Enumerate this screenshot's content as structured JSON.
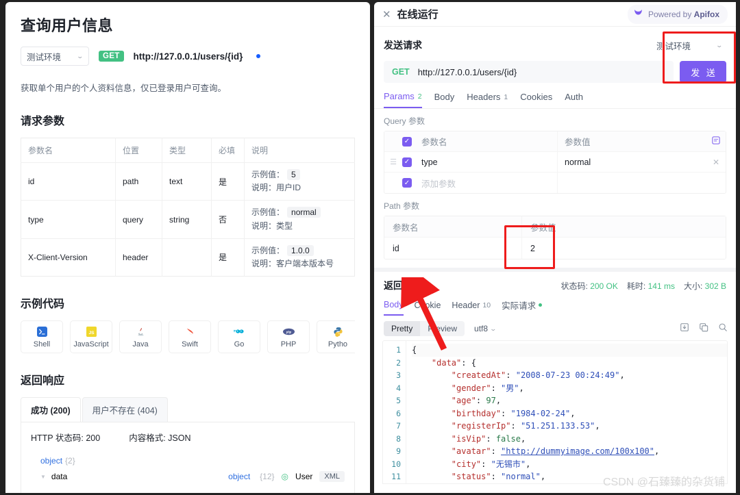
{
  "doc": {
    "title": "查询用户信息",
    "env_label": "测试环境",
    "method": "GET",
    "url": "http://127.0.0.1/users/{id}",
    "description": "获取单个用户的个人资料信息，仅已登录用户可查询。",
    "params_section_title": "请求参数",
    "params_headers": [
      "参数名",
      "位置",
      "类型",
      "必填",
      "说明"
    ],
    "params_rows": [
      {
        "name": "id",
        "position": "path",
        "type": "text",
        "required": "是",
        "example_label": "示例值：",
        "example_value": "5",
        "desc_label": "说明：",
        "desc_value": "用户ID"
      },
      {
        "name": "type",
        "position": "query",
        "type": "string",
        "required": "否",
        "example_label": "示例值：",
        "example_value": "normal",
        "desc_label": "说明：",
        "desc_value": "类型"
      },
      {
        "name": "X-Client-Version",
        "position": "header",
        "type": "",
        "required": "是",
        "example_label": "示例值：",
        "example_value": "1.0.0",
        "desc_label": "说明：",
        "desc_value": "客户端本版本号"
      }
    ],
    "code_section_title": "示例代码",
    "languages": [
      {
        "label": "Shell",
        "icon": "shell-icon"
      },
      {
        "label": "JavaScript",
        "icon": "javascript-icon"
      },
      {
        "label": "Java",
        "icon": "java-icon"
      },
      {
        "label": "Swift",
        "icon": "swift-icon"
      },
      {
        "label": "Go",
        "icon": "go-icon"
      },
      {
        "label": "PHP",
        "icon": "php-icon"
      },
      {
        "label": "Pytho",
        "icon": "python-icon"
      }
    ],
    "more_icon": "more-vertical-icon",
    "response_section_title": "返回响应",
    "response_tabs": [
      {
        "label": "成功 (200)",
        "active": true
      },
      {
        "label": "用户不存在 (404)",
        "active": false
      }
    ],
    "http_status_label": "HTTP 状态码: 200",
    "content_type_label": "内容格式: JSON",
    "tree": {
      "root_type": "object",
      "root_count": "{2}",
      "child_name": "data",
      "child_type": "object",
      "child_count": "{12}",
      "child_ref": "User",
      "child_chip": "XML"
    }
  },
  "run": {
    "header_title": "在线运行",
    "close_icon": "close-icon",
    "powered_prefix": "Powered by ",
    "powered_brand": "Apifox",
    "powered_icon": "apifox-logo-icon",
    "send_section_title": "发送请求",
    "env_label": "测试环境",
    "method": "GET",
    "url": "http://127.0.0.1/users/{id}",
    "send_button": "发 送",
    "tabs": [
      {
        "label": "Params",
        "count": "2",
        "active": true
      },
      {
        "label": "Body",
        "count": "",
        "active": false
      },
      {
        "label": "Headers",
        "count": "1",
        "active": false
      },
      {
        "label": "Cookies",
        "count": "",
        "active": false
      },
      {
        "label": "Auth",
        "count": "",
        "active": false
      }
    ],
    "query_section_label": "Query 参数",
    "query_headers": {
      "name": "参数名",
      "value": "参数值"
    },
    "query_bulk_icon": "bulk-edit-icon",
    "query_rows": [
      {
        "name": "type",
        "value": "normal",
        "checked": true,
        "placeholder": false
      },
      {
        "name": "添加参数",
        "value": "",
        "checked": true,
        "placeholder": true
      }
    ],
    "path_section_label": "Path 参数",
    "path_headers": {
      "name": "参数名",
      "value": "参数值"
    },
    "path_rows": [
      {
        "name": "id",
        "value": "2"
      }
    ],
    "result_title": "返回结果",
    "result_meta": [
      {
        "label": "状态码:",
        "value": "200 OK"
      },
      {
        "label": "耗时:",
        "value": "141 ms"
      },
      {
        "label": "大小:",
        "value": "302 B"
      }
    ],
    "result_tabs": [
      {
        "label": "Body",
        "count": "",
        "active": true,
        "dot": false
      },
      {
        "label": "Cookie",
        "count": "",
        "active": false,
        "dot": false
      },
      {
        "label": "Header",
        "count": "10",
        "active": false,
        "dot": false
      },
      {
        "label": "实际请求",
        "count": "",
        "active": false,
        "dot": true
      }
    ],
    "viewer": {
      "segments": [
        {
          "label": "Pretty",
          "on": true
        },
        {
          "label": "Preview",
          "on": false
        }
      ],
      "encoding": "utf8",
      "icons": [
        "download-icon",
        "copy-icon",
        "search-icon"
      ]
    },
    "code_lines": [
      {
        "n": "1",
        "text": "{"
      },
      {
        "n": "2",
        "text": "    \"data\": {"
      },
      {
        "n": "3",
        "text": "        \"createdAt\": \"2008-07-23 00:24:49\","
      },
      {
        "n": "4",
        "text": "        \"gender\": \"男\","
      },
      {
        "n": "5",
        "text": "        \"age\": 97,"
      },
      {
        "n": "6",
        "text": "        \"birthday\": \"1984-02-24\","
      },
      {
        "n": "7",
        "text": "        \"registerIp\": \"51.251.133.53\","
      },
      {
        "n": "8",
        "text": "        \"isVip\": false,"
      },
      {
        "n": "9",
        "text": "        \"avatar\": \"http://dummyimage.com/100x100\","
      },
      {
        "n": "10",
        "text": "        \"city\": \"无锡市\","
      },
      {
        "n": "11",
        "text": "        \"status\": \"normal\","
      }
    ]
  },
  "watermark": "CSDN @石臻臻的杂货铺",
  "colors": {
    "accent_purple": "#7b5cf0",
    "success_green": "#43c183",
    "annotation_red": "#ee1c1c",
    "link_blue": "#2f6fe0"
  }
}
